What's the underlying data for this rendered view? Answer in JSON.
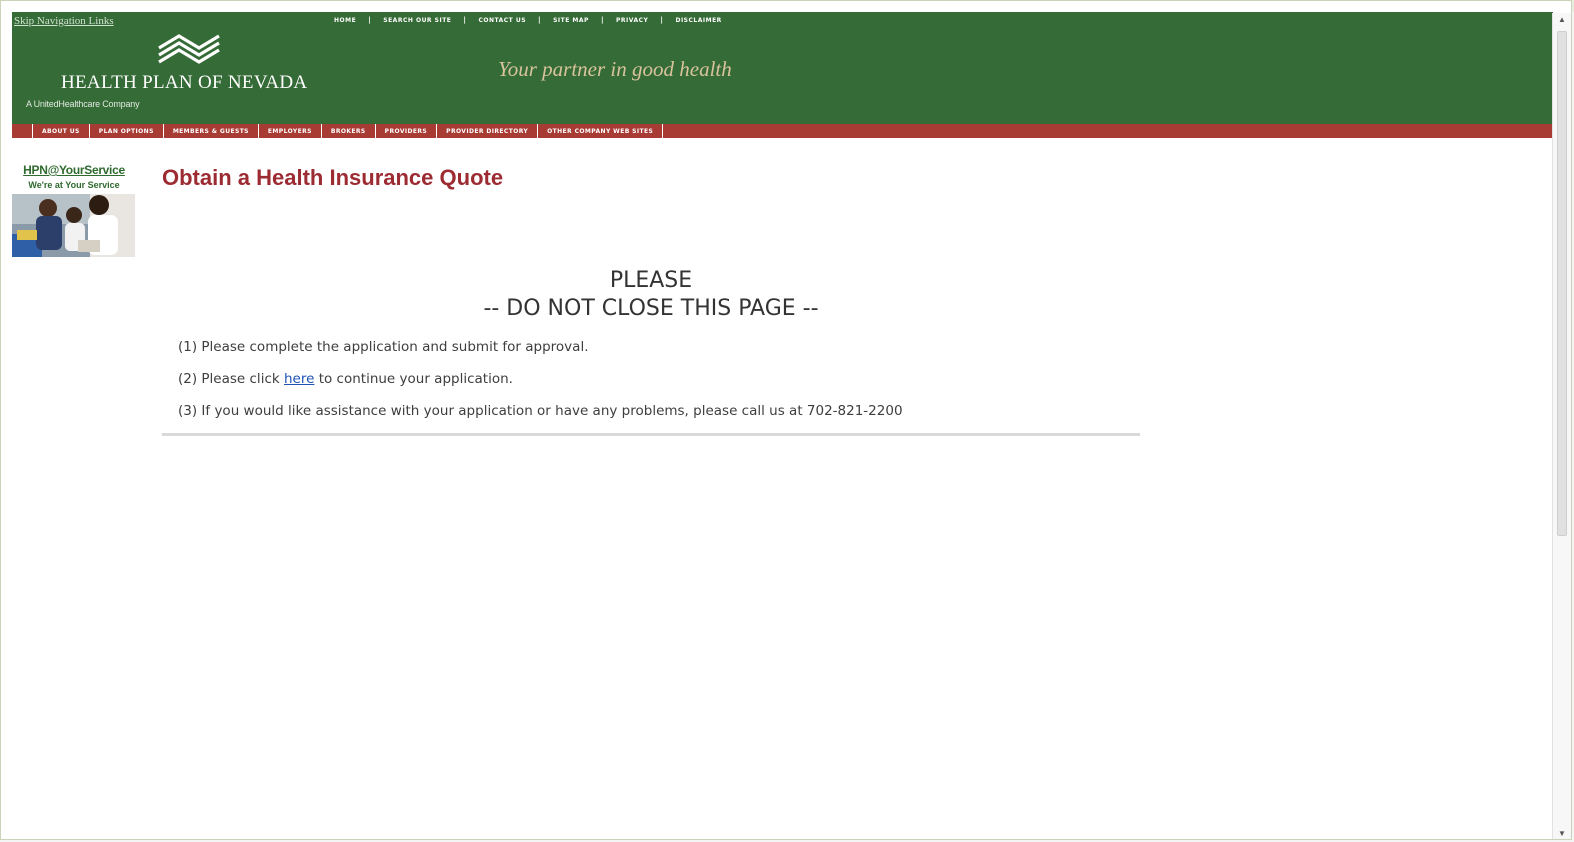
{
  "header": {
    "skip_link": "Skip Navigation Links",
    "top_nav": [
      "HOME",
      "SEARCH OUR SITE",
      "CONTACT US",
      "SITE MAP",
      "PRIVACY",
      "DISCLAIMER"
    ],
    "brand_title": "HEALTH PLAN OF NEVADA",
    "brand_subtitle": "A UnitedHealthcare Company",
    "tagline": "Your partner in good health"
  },
  "main_nav": [
    "ABOUT US",
    "PLAN OPTIONS",
    "MEMBERS & GUESTS",
    "EMPLOYERS",
    "BROKERS",
    "PROVIDERS",
    "PROVIDER DIRECTORY",
    "OTHER COMPANY WEB SITES"
  ],
  "sidebar": {
    "title": "HPN@YourService",
    "subtitle": "We're at Your Service"
  },
  "main": {
    "page_title": "Obtain a Health Insurance Quote",
    "notice_line1": "PLEASE",
    "notice_line2": "-- DO NOT CLOSE THIS PAGE --",
    "step1": "(1) Please complete the application and submit for approval.",
    "step2_prefix": "(2) Please click ",
    "step2_link": "here",
    "step2_suffix": " to continue your application.",
    "step3": "(3) If you would like assistance with your application or have any problems, please call us at 702-821-2200"
  },
  "colors": {
    "header_green": "#356b36",
    "nav_red": "#a93b35",
    "title_red": "#9c2b32",
    "tagline_gold": "#d8c39d",
    "link_blue": "#1f53b8"
  }
}
